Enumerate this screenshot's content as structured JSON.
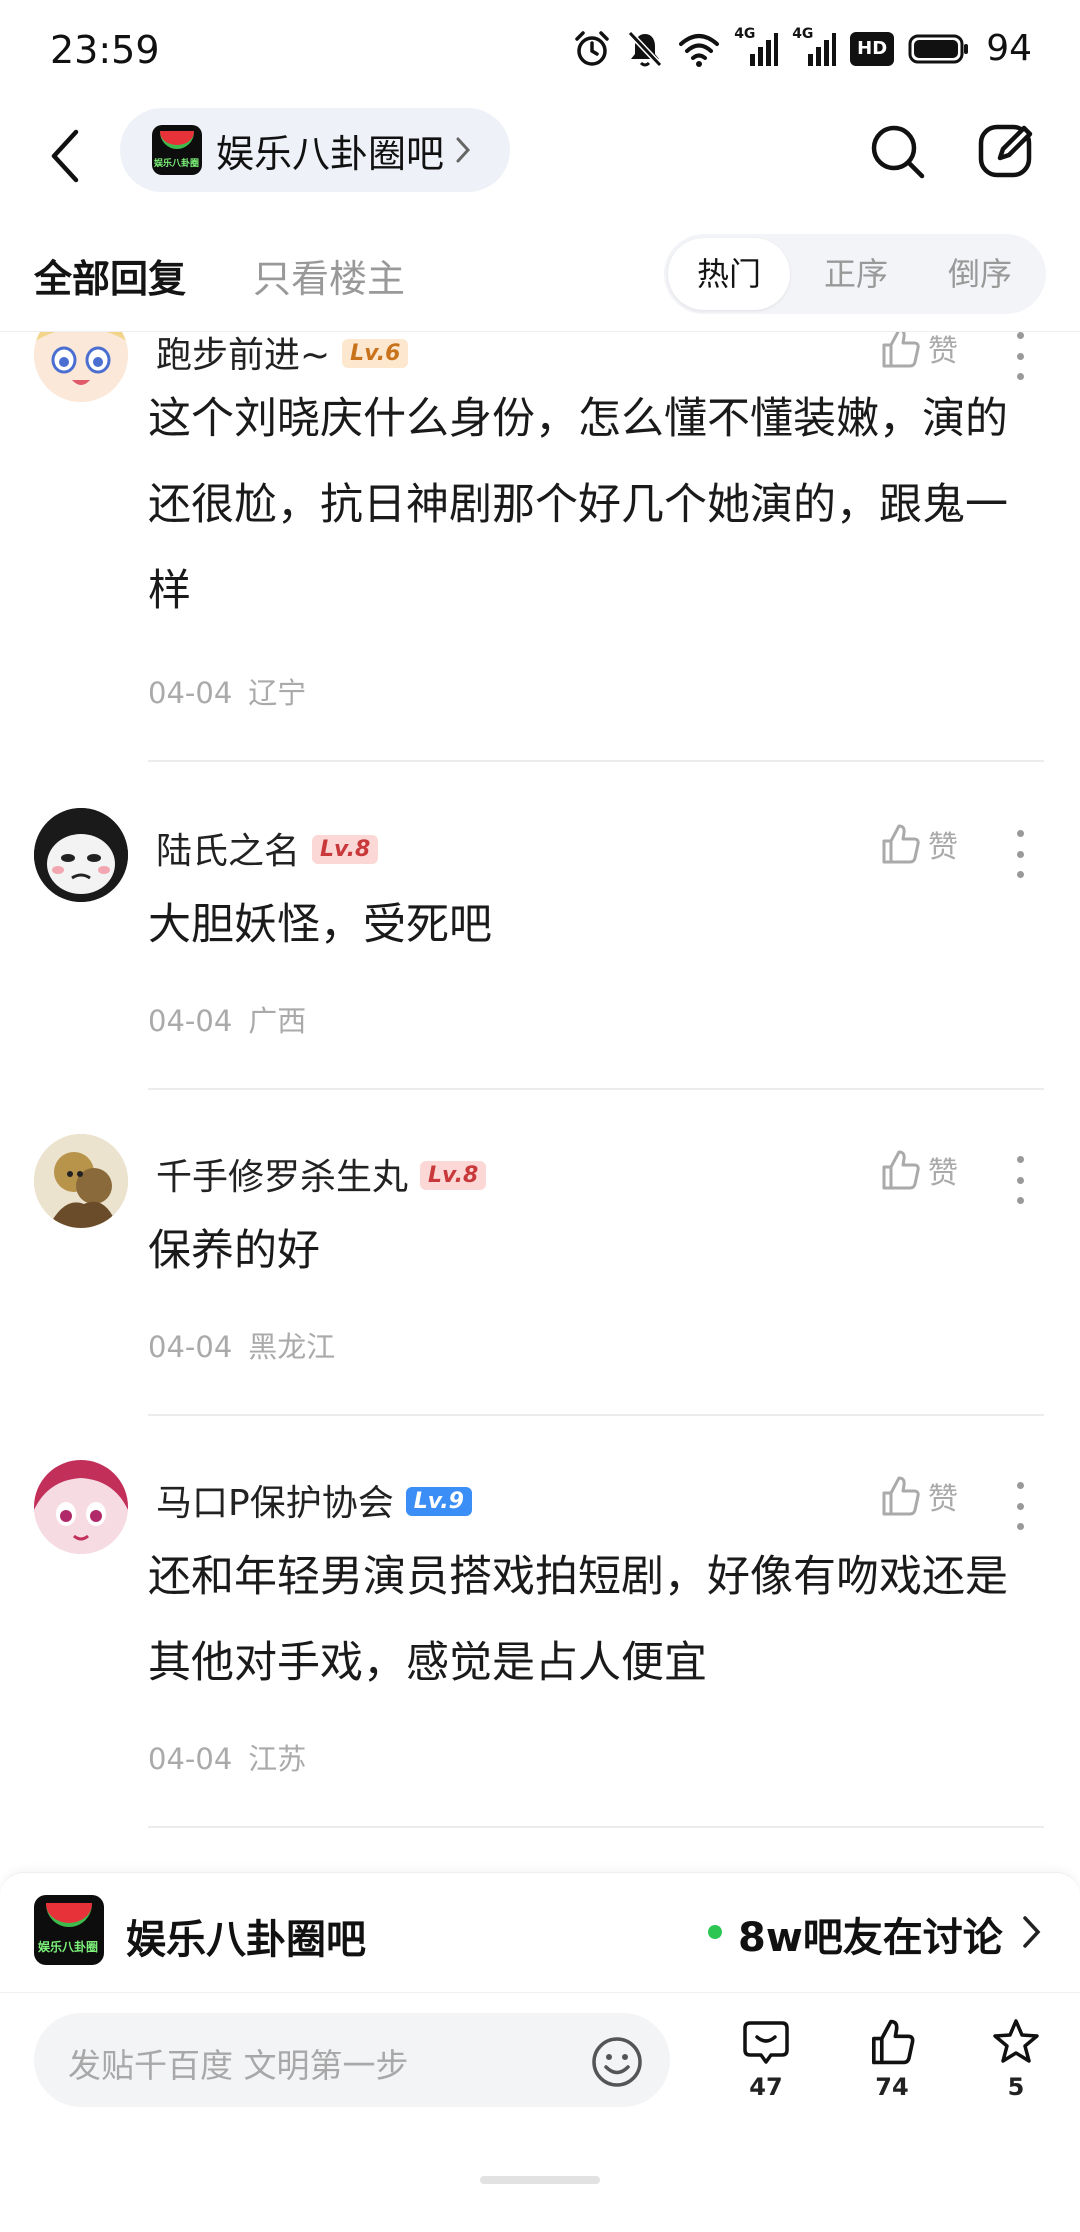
{
  "status_bar": {
    "time": "23:59",
    "icons": [
      "alarm-icon",
      "mute-icon",
      "wifi-icon",
      "signal-4g-icon",
      "signal-4g-icon",
      "hd-icon",
      "battery-icon"
    ],
    "net_label": "4G",
    "hd_label": "HD",
    "battery": "94"
  },
  "nav": {
    "forum_name": "娱乐八卦圈吧",
    "logo_text": "娱乐八卦圈"
  },
  "tabs": {
    "all_replies": "全部回复",
    "only_op": "只看楼主",
    "sort": {
      "hot": "热门",
      "ascending": "正序",
      "descending": "倒序"
    }
  },
  "comments": [
    {
      "username": "跑步前进~",
      "level": "Lv.6",
      "like_label": "赞",
      "text": "这个刘晓庆什么身份，怎么懂不懂装嫩，演的还很尬，抗日神剧那个好几个她演的，跟鬼一样",
      "date": "04-04",
      "location": "辽宁"
    },
    {
      "username": "陆氏之名",
      "level": "Lv.8",
      "like_label": "赞",
      "text": "大胆妖怪，受死吧",
      "date": "04-04",
      "location": "广西"
    },
    {
      "username": "千手修罗杀生丸",
      "level": "Lv.8",
      "like_label": "赞",
      "text": "保养的好",
      "date": "04-04",
      "location": "黑龙江"
    },
    {
      "username": "马口P保护协会",
      "level": "Lv.9",
      "like_label": "赞",
      "text": "还和年轻男演员搭戏拍短剧，好像有吻戏还是其他对手戏，感觉是占人便宜",
      "date": "04-04",
      "location": "江苏"
    }
  ],
  "forum_bar": {
    "name": "娱乐八卦圈吧",
    "online_text": "8w吧友在讨论"
  },
  "action_bar": {
    "input_placeholder": "发贴千百度 文明第一步",
    "reply_count": "47",
    "like_count": "74",
    "favorite_count": "5"
  },
  "colors": {
    "accent_online": "#2dc653",
    "lv6_badge": "#fde7cf",
    "lv8_badge": "#fbd8d6",
    "lv9_badge": "#3b8ef5"
  }
}
